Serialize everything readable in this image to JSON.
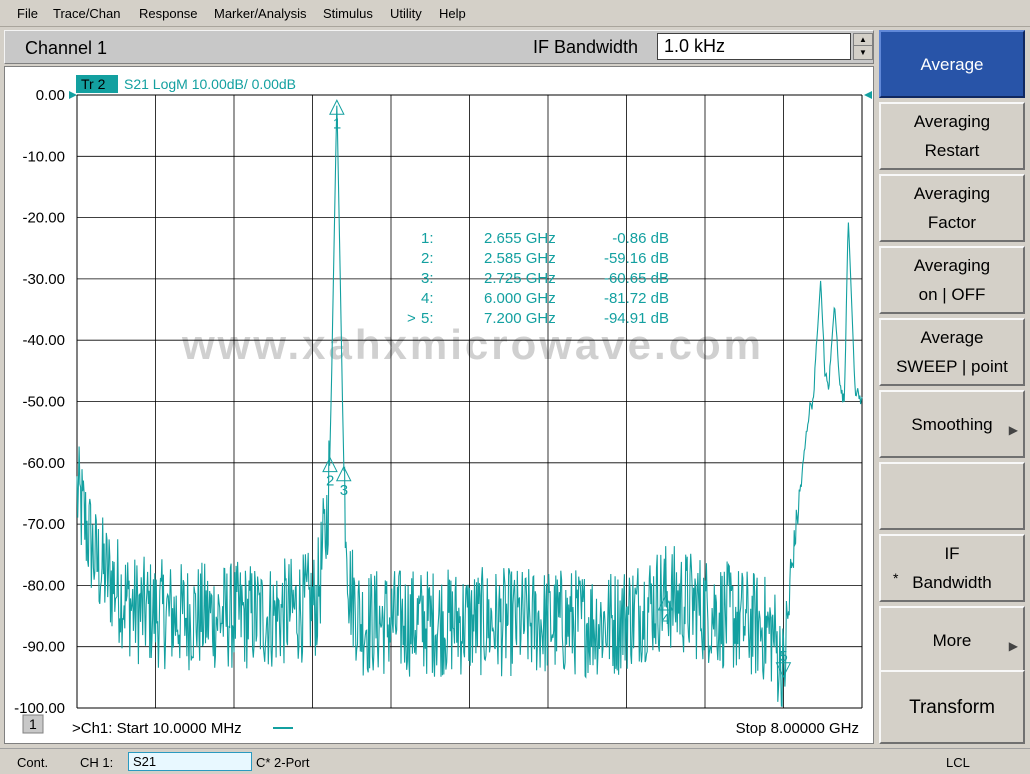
{
  "menu": [
    "File",
    "Trace/Chan",
    "Response",
    "Marker/Analysis",
    "Stimulus",
    "Utility",
    "Help"
  ],
  "channel_title": "Channel 1",
  "ifbw": {
    "label": "IF Bandwidth",
    "value": "1.0 kHz"
  },
  "trace": {
    "tag": "Tr 2",
    "label": "S21 LogM 10.00dB/  0.00dB"
  },
  "colors": {
    "trace": "#13a0a0",
    "accent": "#2854a8",
    "grid": "#000000"
  },
  "chart_data": {
    "type": "line",
    "y_ticks": [
      "0.00",
      "-10.00",
      "-20.00",
      "-30.00",
      "-40.00",
      "-50.00",
      "-60.00",
      "-70.00",
      "-80.00",
      "-90.00",
      "-100.00"
    ],
    "ylim": [
      -100,
      0
    ],
    "xlim_ghz": [
      0.01,
      8.0
    ],
    "grid": true,
    "series": [
      {
        "x": [
          0.01,
          0.2,
          0.6,
          1.0,
          1.5,
          2.0,
          2.45,
          2.55,
          2.585,
          2.62,
          2.655,
          2.69,
          2.725,
          2.78,
          2.9,
          3.5,
          4.5,
          5.5,
          6.0,
          7.0,
          7.1,
          7.2,
          7.3,
          7.45,
          7.48,
          7.5,
          7.58,
          7.62,
          7.66,
          7.72,
          7.78,
          7.82,
          7.86,
          7.93,
          8.0
        ],
        "y": [
          -65,
          -76,
          -84,
          -85,
          -85,
          -85,
          -83,
          -70,
          -59.16,
          -30,
          -0.86,
          -30,
          -60.65,
          -80,
          -86,
          -86,
          -86,
          -86,
          -81.72,
          -87,
          -88,
          -94.91,
          -75,
          -53,
          -50,
          -50.5,
          -30,
          -45,
          -48,
          -34,
          -48,
          -50,
          -20,
          -48,
          -50
        ]
      }
    ],
    "markers": [
      {
        "label": "1",
        "freq_ghz": 2.655,
        "value_db": -0.86
      },
      {
        "label": "2",
        "freq_ghz": 2.585,
        "value_db": -59.16
      },
      {
        "label": "3",
        "freq_ghz": 2.725,
        "value_db": -60.65
      },
      {
        "label": "4",
        "freq_ghz": 6.0,
        "value_db": -81.72
      },
      {
        "label": "5",
        "freq_ghz": 7.2,
        "value_db": -94.91
      }
    ]
  },
  "marker_table": [
    {
      "prefix": "",
      "num": "1:",
      "freq": "2.655 GHz",
      "val": "-0.86 dB"
    },
    {
      "prefix": "",
      "num": "2:",
      "freq": "2.585 GHz",
      "val": "-59.16 dB"
    },
    {
      "prefix": "",
      "num": "3:",
      "freq": "2.725 GHz",
      "val": "-60.65 dB"
    },
    {
      "prefix": "",
      "num": "4:",
      "freq": "6.000 GHz",
      "val": "-81.72 dB"
    },
    {
      "prefix": ">",
      "num": "5:",
      "freq": "7.200 GHz",
      "val": "-94.91 dB"
    }
  ],
  "watermark": "www.xahxmicrowave.com",
  "footer": {
    "channel_num": "1",
    "start": ">Ch1: Start  10.0000 MHz",
    "stop": "Stop  8.00000 GHz"
  },
  "softkeys": [
    {
      "name": "average",
      "lines": [
        "Average"
      ],
      "active": true
    },
    {
      "name": "averaging-restart",
      "lines": [
        "Averaging",
        "Restart"
      ]
    },
    {
      "name": "averaging-factor",
      "lines": [
        "Averaging",
        "Factor"
      ]
    },
    {
      "name": "averaging-on-off",
      "lines": [
        "Averaging",
        "on | OFF"
      ]
    },
    {
      "name": "average-sweep-point",
      "lines": [
        "Average",
        "SWEEP | point"
      ]
    },
    {
      "name": "smoothing",
      "lines": [
        "Smoothing"
      ],
      "arrow": true
    },
    {
      "name": "blank",
      "lines": []
    },
    {
      "name": "if-bandwidth",
      "lines": [
        "IF",
        "Bandwidth"
      ],
      "star": true
    },
    {
      "name": "more",
      "lines": [
        "More"
      ],
      "arrow": true
    },
    {
      "name": "transform",
      "lines": [
        "Transform"
      ]
    }
  ],
  "status": {
    "mode": "Cont.",
    "channel": "CH 1:",
    "meas": "S21",
    "cal": "C* 2-Port",
    "remote": "LCL"
  }
}
